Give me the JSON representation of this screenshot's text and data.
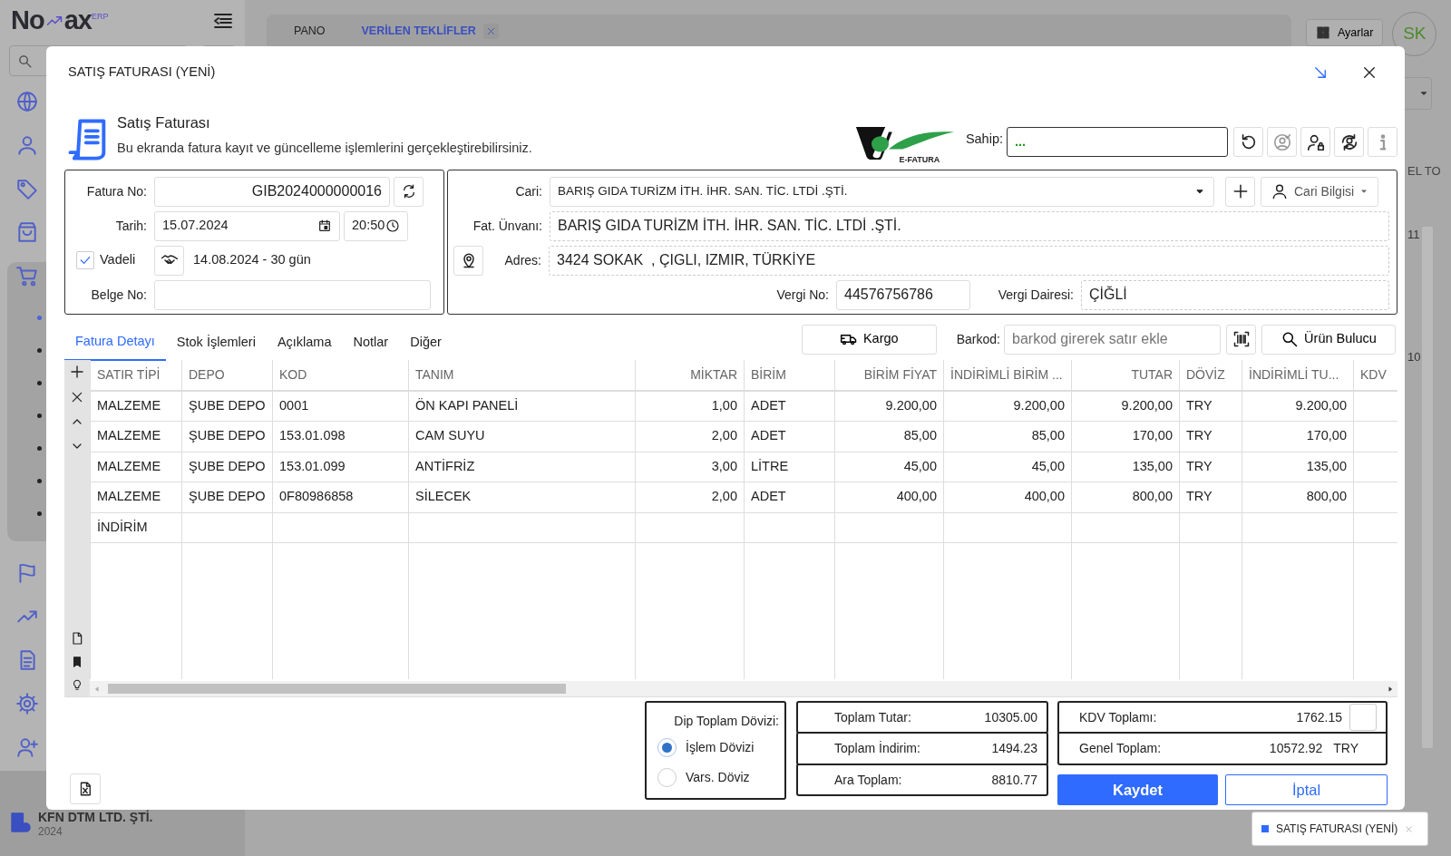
{
  "app": {
    "logo": {
      "left": "No",
      "right": "ax",
      "suffix": "ERP"
    },
    "sidebar": {
      "items": [
        {
          "expanded": false
        },
        {
          "expanded": false
        },
        {
          "expanded": false
        },
        {
          "expanded": false
        },
        {
          "expanded": true,
          "children": [
            {
              "selected": true
            },
            {
              "selected": false
            },
            {
              "selected": false
            },
            {
              "selected": false
            },
            {
              "selected": false
            },
            {
              "selected": false
            },
            {
              "selected": false
            }
          ]
        },
        {
          "expanded": false
        },
        {
          "expanded": false
        },
        {
          "expanded": false
        },
        {
          "expanded": false
        },
        {
          "expanded": false
        }
      ]
    },
    "company": {
      "name": "KFN DTM LTD. ŞTİ.",
      "year": "2024"
    },
    "tabs": [
      {
        "label": "PANO",
        "selected": false,
        "closable": false
      },
      {
        "label": "VERİLEN TEKLİFLER",
        "selected": true,
        "closable": true
      }
    ],
    "settings_button": "Ayarlar",
    "avatar": "SK",
    "background_grid": {
      "header": "EL TO",
      "cells": [
        "11",
        "10"
      ]
    }
  },
  "modal": {
    "title": "SATIŞ FATURASI (YENİ)",
    "heading": "Satış Faturası",
    "description": "Bu ekranda fatura kayıt ve güncelleme işlemlerini gerçekleştirebilirsiniz.",
    "efatura_label": "E-FATURA",
    "owner": {
      "label": "Sahip:",
      "value": "..."
    },
    "invoice": {
      "number": {
        "label": "Fatura No:",
        "value": "GIB2024000000016"
      },
      "date": {
        "label": "Tarih:",
        "value": "15.07.2024",
        "time": "20:50"
      },
      "due": {
        "label": "Vadeli",
        "checked": true,
        "value": "14.08.2024 - 30 gün"
      },
      "document": {
        "label": "Belge No:"
      }
    },
    "customer": {
      "account": {
        "label": "Cari:",
        "value": "BARIŞ GIDA TURİZM İTH. İHR. SAN. TİC. LTDİ .ŞTİ."
      },
      "info_button": "Cari Bilgisi",
      "title": {
        "label": "Fat. Ünvanı:",
        "value": "BARIŞ GIDA TURİZM İTH. İHR. SAN. TİC. LTDİ .ŞTİ."
      },
      "address": {
        "label": "Adres:",
        "value": "3424 SOKAK  , ÇIGLI, IZMIR, TÜRKİYE"
      },
      "tax_no": {
        "label": "Vergi No:",
        "value": "44576756786"
      },
      "tax_office": {
        "label": "Vergi Dairesi:",
        "value": "ÇİĞLİ"
      }
    },
    "detail_tabs": [
      {
        "label": "Fatura Detayı",
        "selected": true
      },
      {
        "label": "Stok İşlemleri",
        "selected": false
      },
      {
        "label": "Açıklama",
        "selected": false
      },
      {
        "label": "Notlar",
        "selected": false
      },
      {
        "label": "Diğer",
        "selected": false
      }
    ],
    "cargo_button": "Kargo",
    "barcode": {
      "label": "Barkod:",
      "placeholder": "barkod girerek satır ekle"
    },
    "product_finder": "Ürün Bulucu",
    "table": {
      "columns": [
        {
          "label": "SATIR TİPİ",
          "numeric": false,
          "header_right": false
        },
        {
          "label": "DEPO",
          "numeric": false,
          "header_right": false
        },
        {
          "label": "KOD",
          "numeric": false,
          "header_right": false
        },
        {
          "label": "TANIM",
          "numeric": false,
          "header_right": false
        },
        {
          "label": "MİKTAR",
          "numeric": true,
          "header_right": true
        },
        {
          "label": "BİRİM",
          "numeric": false,
          "header_right": false
        },
        {
          "label": "BİRİM FİYAT",
          "numeric": true,
          "header_right": true
        },
        {
          "label": "İNDİRİMLİ BİRİM ...",
          "numeric": true,
          "header_right": false
        },
        {
          "label": "TUTAR",
          "numeric": true,
          "header_right": true
        },
        {
          "label": "DÖVİZ",
          "numeric": false,
          "header_right": false
        },
        {
          "label": "İNDİRİMLİ TU...",
          "numeric": true,
          "header_right": false
        },
        {
          "label": "KDV",
          "header_right": false
        }
      ],
      "rows": [
        [
          "MALZEME",
          "ŞUBE DEPO",
          "0001",
          "ÖN KAPI PANELİ",
          "1,00",
          "ADET",
          "9.200,00",
          "9.200,00",
          "9.200,00",
          "TRY",
          "9.200,00"
        ],
        [
          "MALZEME",
          "ŞUBE DEPO",
          "153.01.098",
          "CAM SUYU",
          "2,00",
          "ADET",
          "85,00",
          "85,00",
          "170,00",
          "TRY",
          "170,00"
        ],
        [
          "MALZEME",
          "ŞUBE DEPO",
          "153.01.099",
          "ANTİFRİZ",
          "3,00",
          "LİTRE",
          "45,00",
          "45,00",
          "135,00",
          "TRY",
          "135,00"
        ],
        [
          "MALZEME",
          "ŞUBE DEPO",
          "0F80986858",
          "SİLECEK",
          "2,00",
          "ADET",
          "400,00",
          "400,00",
          "800,00",
          "TRY",
          "800,00"
        ],
        [
          "İNDİRİM"
        ]
      ]
    },
    "totals": {
      "currency_title": "Dip Toplam Dövizi:",
      "currency_options": [
        {
          "label": "İşlem Dövizi",
          "selected": true
        },
        {
          "label": "Vars. Döviz",
          "selected": false
        }
      ],
      "sums": [
        {
          "label": "Toplam Tutar:",
          "value": "10305.00"
        },
        {
          "label": "Toplam İndirim:",
          "value": "1494.23"
        },
        {
          "label": "Ara Toplam:",
          "value": "8810.77"
        }
      ],
      "vat_total": {
        "label": "KDV Toplamı:",
        "value": "1762.15"
      },
      "grand_total": {
        "label": "Genel Toplam:",
        "value": "10572.92",
        "currency": "TRY"
      }
    },
    "save_button": "Kaydet",
    "cancel_button": "İptal"
  },
  "taskbar": [
    {
      "label": "SATIŞ FATURASI (YENİ)",
      "selected": true
    }
  ]
}
